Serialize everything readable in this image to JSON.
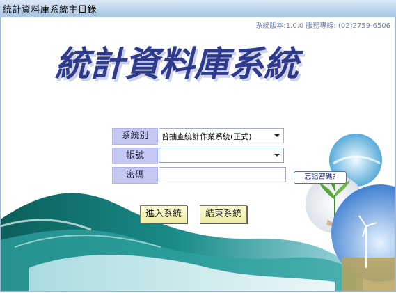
{
  "window": {
    "title": "統計資料庫系統主目錄"
  },
  "header": {
    "version_info": "系統版本:1.0.0  服務專線: (02)2759-6506"
  },
  "banner": {
    "title": "統計資料庫系統"
  },
  "form": {
    "system_label": "系統別",
    "system_value": "普抽查統計作業系統(正式)",
    "account_label": "帳號",
    "account_value": "",
    "password_label": "密碼",
    "password_value": "",
    "forgot_password": "忘記密碼?"
  },
  "buttons": {
    "login": "進入系統",
    "exit": "結束系統"
  },
  "colors": {
    "banner_text": "#2e3a8c",
    "label_bg": "#c5c8f2",
    "button_bg": "#f6f3c4"
  }
}
